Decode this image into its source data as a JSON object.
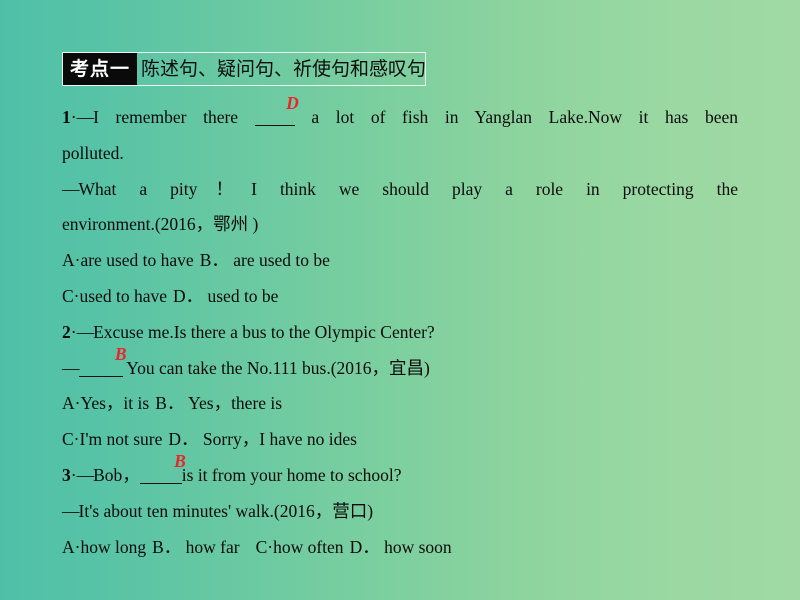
{
  "theme": {
    "bg_left": "#4fc0a8",
    "bg_right": "#a0d9a4",
    "answer_color": "#e8262b",
    "tag_bg": "#0a0a0a",
    "tag_fg": "#ffffff",
    "text_color": "#0b0b0b"
  },
  "section": {
    "tag": "考点一",
    "title": "陈述句、疑问句、祈使句和感叹句"
  },
  "questions": [
    {
      "number": "1",
      "num_dot": "·",
      "answer": "D",
      "lines": [
        {
          "type": "justify",
          "segments": [
            {
              "kind": "num",
              "text": "1"
            },
            {
              "kind": "text",
              "text": "·"
            },
            {
              "kind": "dash",
              "text": "—"
            },
            {
              "kind": "text",
              "text": "I remember there "
            },
            {
              "kind": "blank",
              "width": "w1",
              "answer": "D"
            },
            {
              "kind": "text",
              "text": " a lot of fish in Yanglan Lake.Now it has been"
            }
          ]
        },
        {
          "type": "plain",
          "segments": [
            {
              "kind": "text",
              "text": "polluted."
            }
          ]
        },
        {
          "type": "justify",
          "segments": [
            {
              "kind": "dash",
              "text": "—"
            },
            {
              "kind": "text",
              "text": "What a pity！I think we should play a role in protecting the"
            }
          ]
        },
        {
          "type": "plain",
          "segments": [
            {
              "kind": "text",
              "text": "environment.(2016，鄂州 )"
            }
          ]
        }
      ],
      "option_lines": [
        [
          {
            "label": "A",
            "sep": "·",
            "text": "are used to have"
          },
          {
            "label": "B",
            "sep": "．",
            "text": "are used to be"
          }
        ],
        [
          {
            "label": "C",
            "sep": "·",
            "text": "used to have"
          },
          {
            "label": "D",
            "sep": "．",
            "text": "used to be"
          }
        ]
      ]
    },
    {
      "number": "2",
      "num_dot": "·",
      "answer": "B",
      "lines": [
        {
          "type": "plain",
          "segments": [
            {
              "kind": "num",
              "text": "2"
            },
            {
              "kind": "text",
              "text": "·"
            },
            {
              "kind": "dash",
              "text": "—"
            },
            {
              "kind": "text",
              "text": "Excuse me.Is there a bus to the Olympic Center?"
            }
          ]
        },
        {
          "type": "plain",
          "segments": [
            {
              "kind": "dash",
              "text": "—"
            },
            {
              "kind": "blank",
              "width": "w2",
              "answer": "B"
            },
            {
              "kind": "text",
              "text": " You can take the No.111 bus.(2016，宜昌)"
            }
          ]
        }
      ],
      "option_lines": [
        [
          {
            "label": "A",
            "sep": "·",
            "text": "Yes，it is"
          },
          {
            "label": "B",
            "sep": "．",
            "text": "Yes，there is"
          }
        ],
        [
          {
            "label": "C",
            "sep": "·",
            "text": "I'm not sure"
          },
          {
            "label": "D",
            "sep": "．",
            "text": "Sorry，I have no ides"
          }
        ]
      ]
    },
    {
      "number": "3",
      "num_dot": "·",
      "answer": "B",
      "lines": [
        {
          "type": "plain",
          "segments": [
            {
              "kind": "num",
              "text": "3"
            },
            {
              "kind": "text",
              "text": "·"
            },
            {
              "kind": "dash",
              "text": "—"
            },
            {
              "kind": "text",
              "text": "Bob，"
            },
            {
              "kind": "blank",
              "width": "w3",
              "answer": "B"
            },
            {
              "kind": "text",
              "text": "is it from your home to school?"
            }
          ]
        },
        {
          "type": "plain",
          "segments": [
            {
              "kind": "dash",
              "text": "—"
            },
            {
              "kind": "text",
              "text": "It's about ten minutes' walk.(2016，营口)"
            }
          ]
        }
      ],
      "option_lines": [
        [
          {
            "label": "A",
            "sep": "·",
            "text": "how long"
          },
          {
            "label": "B",
            "sep": "．",
            "text": "how far"
          },
          {
            "label": "C",
            "sep": "·",
            "text": "how often"
          },
          {
            "label": "D",
            "sep": "．",
            "text": "how soon"
          }
        ]
      ]
    }
  ]
}
